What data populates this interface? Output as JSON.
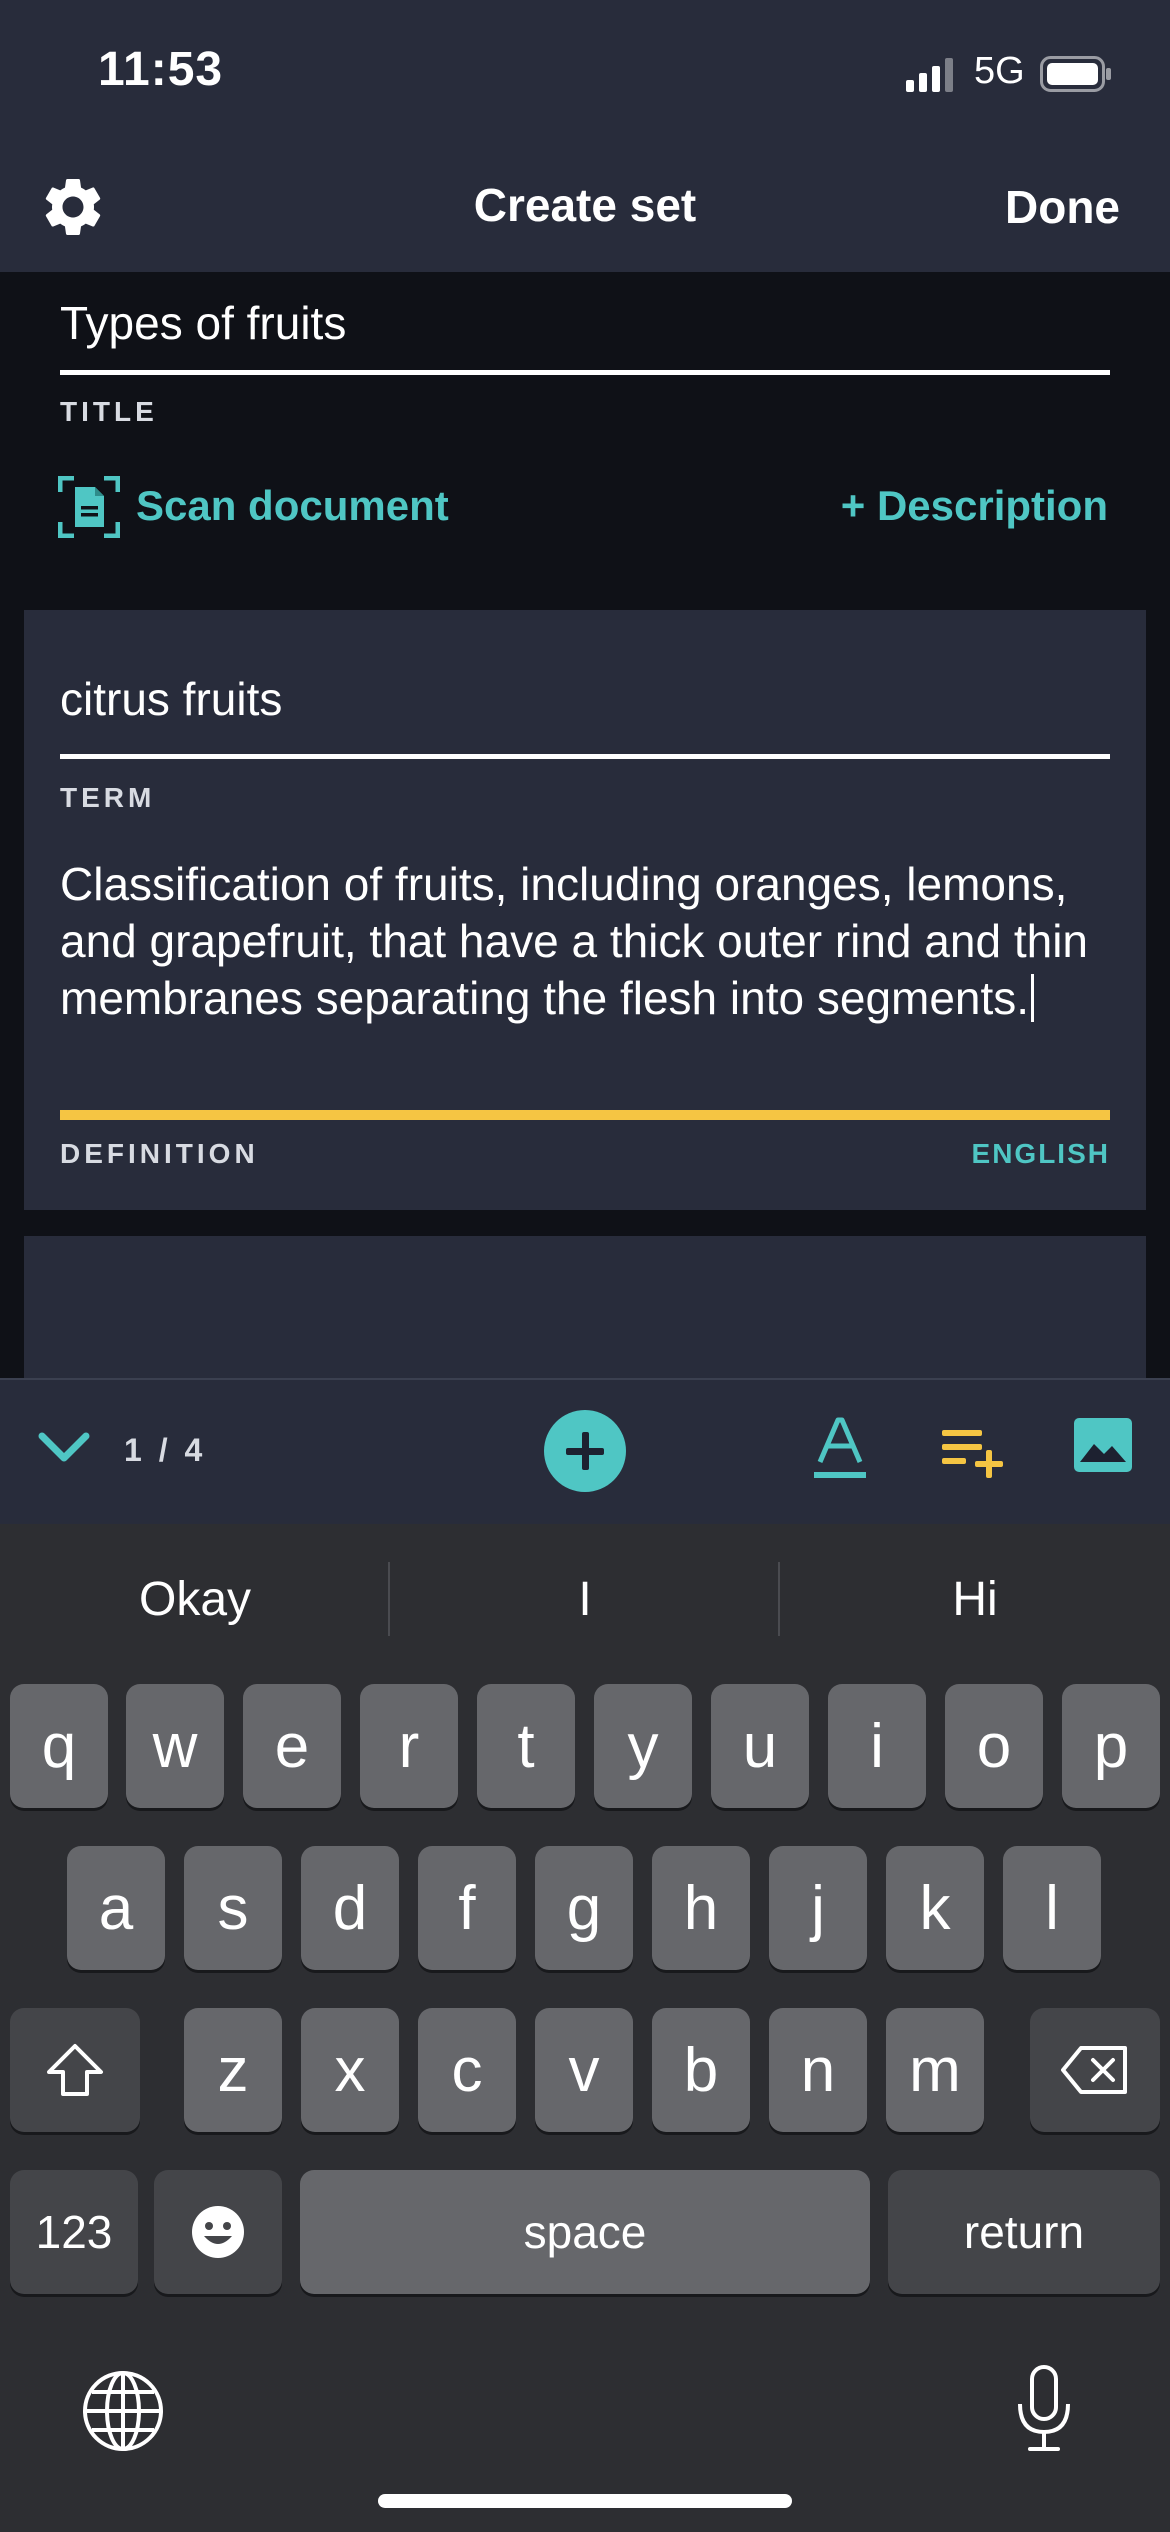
{
  "status_bar": {
    "time": "11:53",
    "network": "5G"
  },
  "nav": {
    "title": "Create set",
    "done_label": "Done"
  },
  "set": {
    "title_value": "Types of fruits",
    "title_label": "TITLE",
    "scan_label": "Scan document",
    "description_label": "+ Description"
  },
  "card": {
    "term_value": "citrus fruits",
    "term_label": "TERM",
    "definition_value": "Classification of fruits, including oranges, lemons, and grapefruit, that have a thick outer rind and thin membranes separating the flesh into segments.",
    "definition_label": "DEFINITION",
    "language_label": "ENGLISH"
  },
  "toolbar": {
    "counter": "1 / 4"
  },
  "keyboard": {
    "suggestions": [
      "Okay",
      "I",
      "Hi"
    ],
    "row1": [
      "q",
      "w",
      "e",
      "r",
      "t",
      "y",
      "u",
      "i",
      "o",
      "p"
    ],
    "row2": [
      "a",
      "s",
      "d",
      "f",
      "g",
      "h",
      "j",
      "k",
      "l"
    ],
    "row3": [
      "z",
      "x",
      "c",
      "v",
      "b",
      "n",
      "m"
    ],
    "numbers_label": "123",
    "space_label": "space",
    "return_label": "return"
  },
  "colors": {
    "accent": "#4fc6c4",
    "highlight": "#f5c543",
    "nav_bg": "#282c3b",
    "page_bg": "#0f1117"
  },
  "icons": [
    "gear-icon",
    "scan-document-icon",
    "chevron-down-icon",
    "plus-icon",
    "text-format-icon",
    "add-list-icon",
    "image-icon",
    "shift-icon",
    "delete-icon",
    "emoji-icon",
    "globe-icon",
    "microphone-icon"
  ]
}
